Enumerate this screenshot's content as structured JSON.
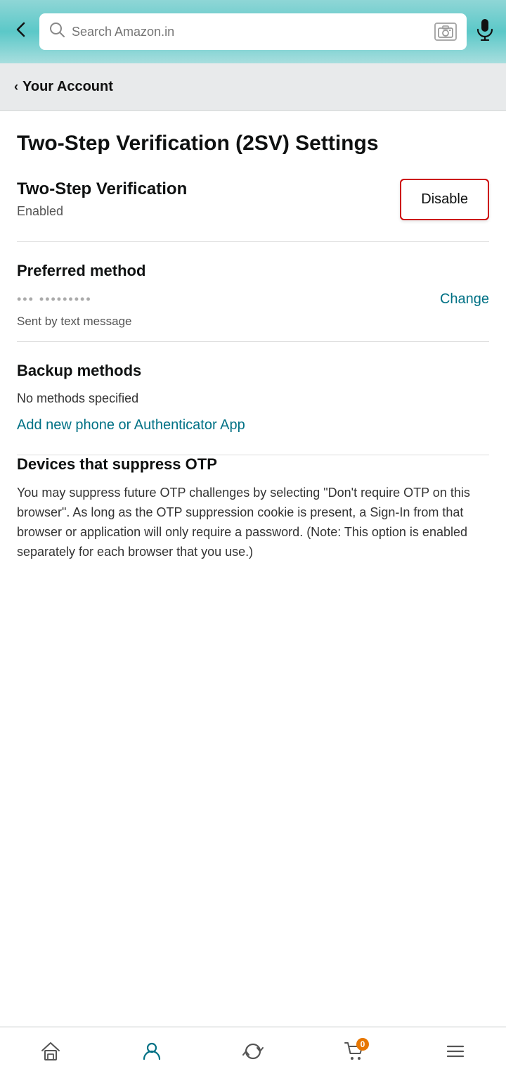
{
  "header": {
    "back_label": "←",
    "search_placeholder": "Search Amazon.in",
    "mic_label": "🎙"
  },
  "breadcrumb": {
    "chevron": "‹",
    "label": "Your Account"
  },
  "page": {
    "title": "Two-Step Verification (2SV) Settings"
  },
  "two_step": {
    "heading": "Two-Step Verification",
    "status": "Enabled",
    "disable_label": "Disable"
  },
  "preferred_method": {
    "section_title": "Preferred method",
    "phone_masked": "••• •••••••••",
    "change_label": "Change",
    "sent_by": "Sent by text message"
  },
  "backup_methods": {
    "section_title": "Backup methods",
    "no_methods_text": "No methods specified",
    "add_link_label": "Add new phone or Authenticator App"
  },
  "devices": {
    "section_title": "Devices that suppress OTP",
    "description": "You may suppress future OTP challenges by selecting \"Don't require OTP on this browser\". As long as the OTP suppression cookie is present, a Sign-In from that browser or application will only require a password. (Note: This option is enabled separately for each browser that you use.)"
  },
  "bottom_nav": {
    "home_label": "home",
    "person_label": "account",
    "refresh_label": "updates",
    "cart_label": "cart",
    "cart_count": "0",
    "menu_label": "menu"
  }
}
